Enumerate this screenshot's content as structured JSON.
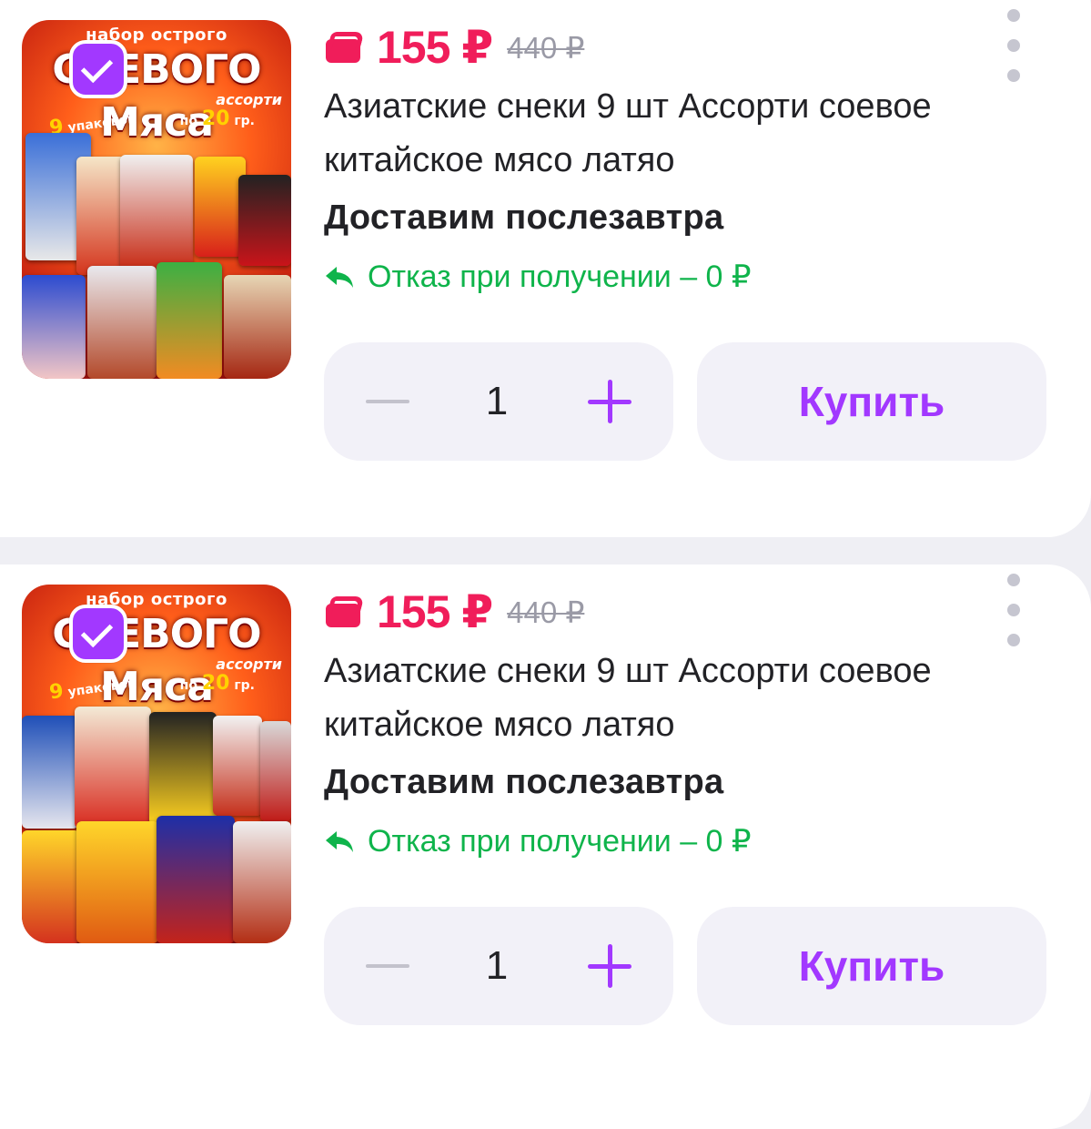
{
  "products": [
    {
      "image": {
        "top_line": "набор острого",
        "big_title": "СОЕВОГО Мяса",
        "sub_tag": "ассорти",
        "count_num": "9",
        "count_word": "упаковок",
        "weight_prefix": "по",
        "weight_num": "20",
        "weight_unit": "гр."
      },
      "selected": true,
      "price": "155 ₽",
      "old_price": "440 ₽",
      "title": "Азиатские снеки 9 шт Ассорти соевое китайское мясо латяо",
      "delivery": "Доставим послезавтра",
      "refund": "Отказ при получении – 0 ₽",
      "quantity": "1",
      "buy_label": "Купить"
    },
    {
      "image": {
        "top_line": "набор острого",
        "big_title": "СОЕВОГО Мяса",
        "sub_tag": "ассорти",
        "count_num": "9",
        "count_word": "упаковок",
        "weight_prefix": "по",
        "weight_num": "20",
        "weight_unit": "гр."
      },
      "selected": true,
      "price": "155 ₽",
      "old_price": "440 ₽",
      "title": "Азиатские снеки 9 шт Ассорти соевое китайское мясо латяо",
      "delivery": "Доставим послезавтра",
      "refund": "Отказ при получении – 0 ₽",
      "quantity": "1",
      "buy_label": "Купить"
    }
  ],
  "colors": {
    "accent": "#a238ff",
    "price": "#f01d5a",
    "refund": "#0fb44b",
    "control_bg": "#f2f1f8",
    "page_bg": "#efeff4"
  },
  "icons": {
    "price": "wallet-icon",
    "refund": "return-arrow-icon",
    "menu": "more-vertical-icon",
    "check": "checkbox-checked-icon",
    "decrease": "minus-icon",
    "increase": "plus-icon"
  }
}
